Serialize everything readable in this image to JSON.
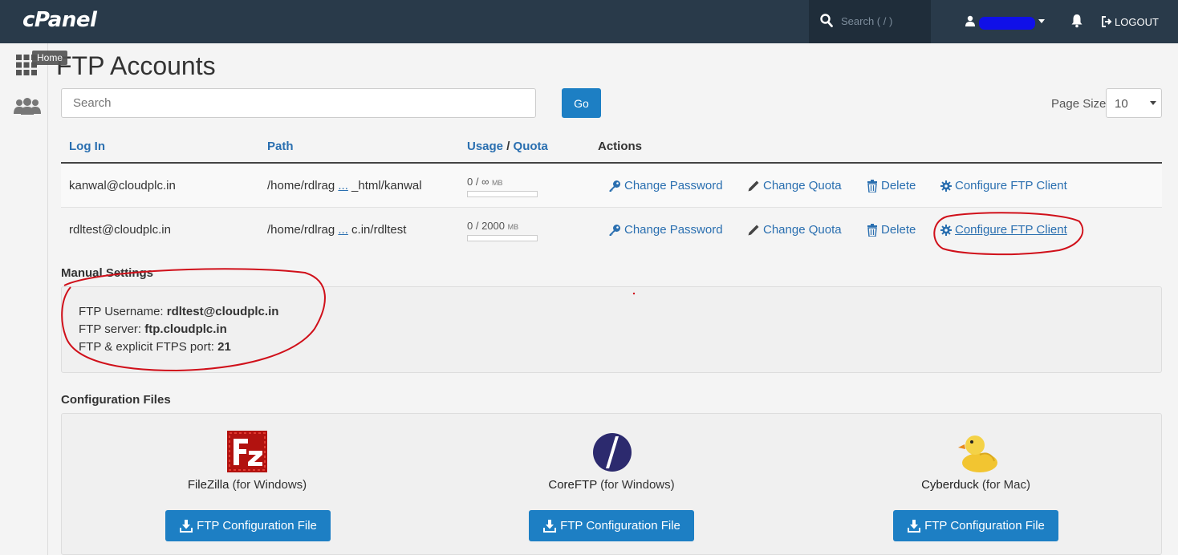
{
  "topbar": {
    "logo": "cPanel",
    "search_placeholder": "Search ( / )",
    "logout_label": "LOGOUT"
  },
  "sidebar": {
    "home_tooltip": "Home"
  },
  "page": {
    "title": "FTP Accounts"
  },
  "search": {
    "placeholder": "Search",
    "go_label": "Go"
  },
  "page_size": {
    "label": "Page Size",
    "value": "10"
  },
  "table": {
    "headers": {
      "login": "Log In",
      "path": "Path",
      "usage": "Usage",
      "slash": " / ",
      "quota": "Quota",
      "actions": "Actions"
    },
    "rows": [
      {
        "login": "kanwal@cloudplc.in",
        "path_start": "/home/rdlrag ",
        "path_ellipsis": "...",
        "path_end": " _html/kanwal",
        "usage": "0 / ∞",
        "unit": "MB",
        "usage_fraction": 0
      },
      {
        "login": "rdltest@cloudplc.in",
        "path_start": "/home/rdlrag ",
        "path_ellipsis": "...",
        "path_end": " c.in/rdltest",
        "usage": "0 / 2000",
        "unit": "MB",
        "usage_fraction": 0
      }
    ],
    "actions": {
      "change_password": "Change Password",
      "change_quota": "Change Quota",
      "delete": "Delete",
      "configure": "Configure FTP Client"
    }
  },
  "manual_settings": {
    "heading": "Manual Settings",
    "username_label": "FTP Username: ",
    "username_value": "rdltest@cloudplc.in",
    "server_label": "FTP server: ",
    "server_value": "ftp.cloudplc.in",
    "port_label": "FTP & explicit FTPS port:  ",
    "port_value": "21"
  },
  "config_files": {
    "heading": "Configuration Files",
    "clients": [
      {
        "name": "FileZilla",
        "platform": " (for Windows)",
        "button": "FTP Configuration File",
        "icon": "filezilla-icon"
      },
      {
        "name": "CoreFTP",
        "platform": " (for Windows)",
        "button": "FTP Configuration File",
        "icon": "coreftp-icon"
      },
      {
        "name": "Cyberduck",
        "platform": " (for Mac)",
        "button": "FTP Configuration File",
        "icon": "cyberduck-icon"
      }
    ]
  },
  "colors": {
    "topbar": "#293a4a",
    "link": "#2a6fb0",
    "primary_button": "#1d7fc4",
    "annotation": "#d0101a"
  }
}
